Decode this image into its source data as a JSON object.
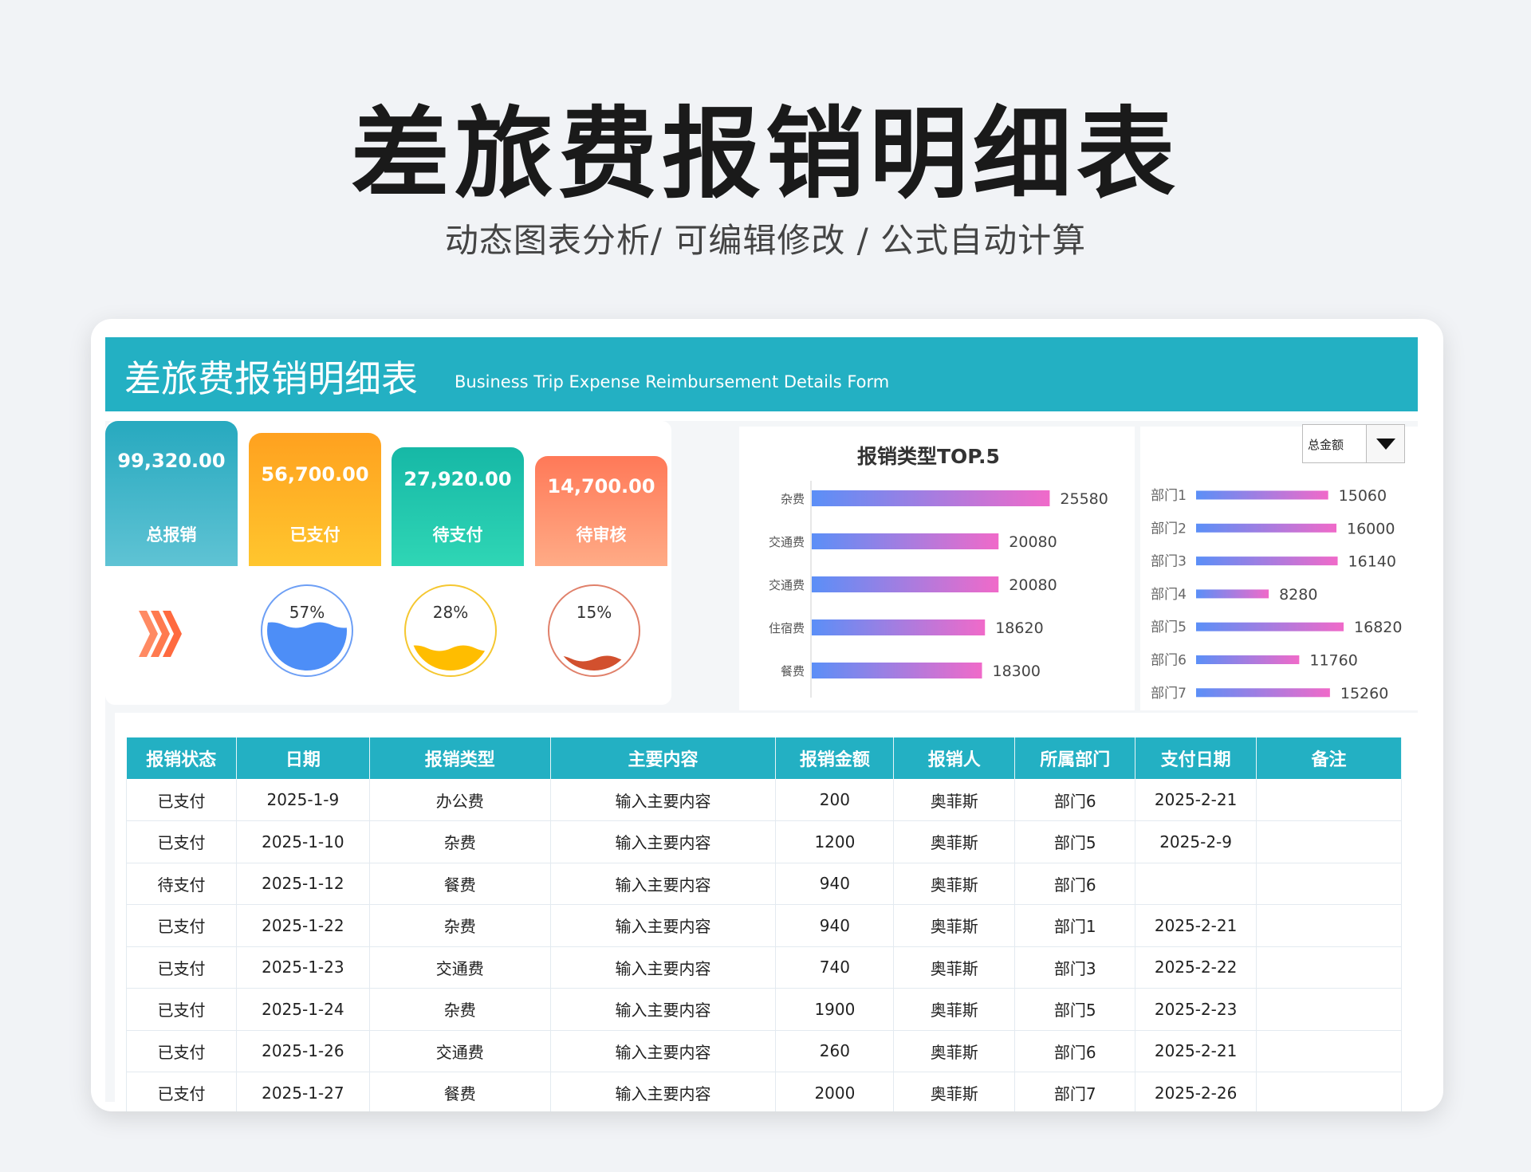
{
  "hero": {
    "title": "差旅费报销明细表",
    "subtitle": "动态图表分析/  可编辑修改  / 公式自动计算"
  },
  "banner": {
    "title": "差旅费报销明细表",
    "subtitle": "Business Trip Expense Reimbursement Details Form"
  },
  "kpis": [
    {
      "value": "99,320.00",
      "label": "总报销"
    },
    {
      "value": "56,700.00",
      "label": "已支付"
    },
    {
      "value": "27,920.00",
      "label": "待支付"
    },
    {
      "value": "14,700.00",
      "label": "待审核"
    }
  ],
  "gauges": [
    {
      "label": "57%",
      "value": 0.57,
      "color": "#4d8ef7",
      "ring": "#6d9ff5"
    },
    {
      "label": "28%",
      "value": 0.28,
      "color": "#ffbd00",
      "ring": "#f5c730"
    },
    {
      "label": "15%",
      "value": 0.15,
      "color": "#d2502e",
      "ring": "#e0806a"
    }
  ],
  "colors": {
    "accent": "#23b0c3",
    "kpi1": [
      "#27a9bf",
      "#5fc3d4"
    ],
    "kpi2": [
      "#ffa11f",
      "#ffc62e"
    ],
    "kpi3": [
      "#16b8a6",
      "#2fd6b5"
    ],
    "kpi4": [
      "#ff7958",
      "#ffab86"
    ],
    "bar_gradient": [
      "#5b8ff7",
      "#f06ac9"
    ],
    "chevron": "#ff7a4f"
  },
  "dropdown": {
    "selected": "总金额",
    "icon": "caret-down-icon"
  },
  "chart_data": [
    {
      "type": "bar",
      "orientation": "horizontal",
      "title": "报销类型TOP.5",
      "categories": [
        "杂费",
        "交通费",
        "交通费",
        "住宿费",
        "餐费"
      ],
      "values": [
        25580,
        20080,
        20080,
        18620,
        18300
      ],
      "xlim": [
        0,
        30000
      ]
    },
    {
      "type": "bar",
      "orientation": "horizontal",
      "title": "",
      "categories": [
        "部门1",
        "部门2",
        "部门3",
        "部门4",
        "部门5",
        "部门6",
        "部门7"
      ],
      "values": [
        15060,
        16000,
        16140,
        8280,
        16820,
        11760,
        15260
      ],
      "xlim": [
        0,
        20000
      ]
    }
  ],
  "table": {
    "headers": [
      "报销状态",
      "日期",
      "报销类型",
      "主要内容",
      "报销金额",
      "报销人",
      "所属部门",
      "支付日期",
      "备注"
    ],
    "rows": [
      [
        "已支付",
        "2025-1-9",
        "办公费",
        "输入主要内容",
        "200",
        "奥菲斯",
        "部门6",
        "2025-2-21",
        ""
      ],
      [
        "已支付",
        "2025-1-10",
        "杂费",
        "输入主要内容",
        "1200",
        "奥菲斯",
        "部门5",
        "2025-2-9",
        ""
      ],
      [
        "待支付",
        "2025-1-12",
        "餐费",
        "输入主要内容",
        "940",
        "奥菲斯",
        "部门6",
        "",
        ""
      ],
      [
        "已支付",
        "2025-1-22",
        "杂费",
        "输入主要内容",
        "940",
        "奥菲斯",
        "部门1",
        "2025-2-21",
        ""
      ],
      [
        "已支付",
        "2025-1-23",
        "交通费",
        "输入主要内容",
        "740",
        "奥菲斯",
        "部门3",
        "2025-2-22",
        ""
      ],
      [
        "已支付",
        "2025-1-24",
        "杂费",
        "输入主要内容",
        "1900",
        "奥菲斯",
        "部门5",
        "2025-2-23",
        ""
      ],
      [
        "已支付",
        "2025-1-26",
        "交通费",
        "输入主要内容",
        "260",
        "奥菲斯",
        "部门6",
        "2025-2-21",
        ""
      ],
      [
        "已支付",
        "2025-1-27",
        "餐费",
        "输入主要内容",
        "2000",
        "奥菲斯",
        "部门7",
        "2025-2-26",
        ""
      ]
    ]
  }
}
